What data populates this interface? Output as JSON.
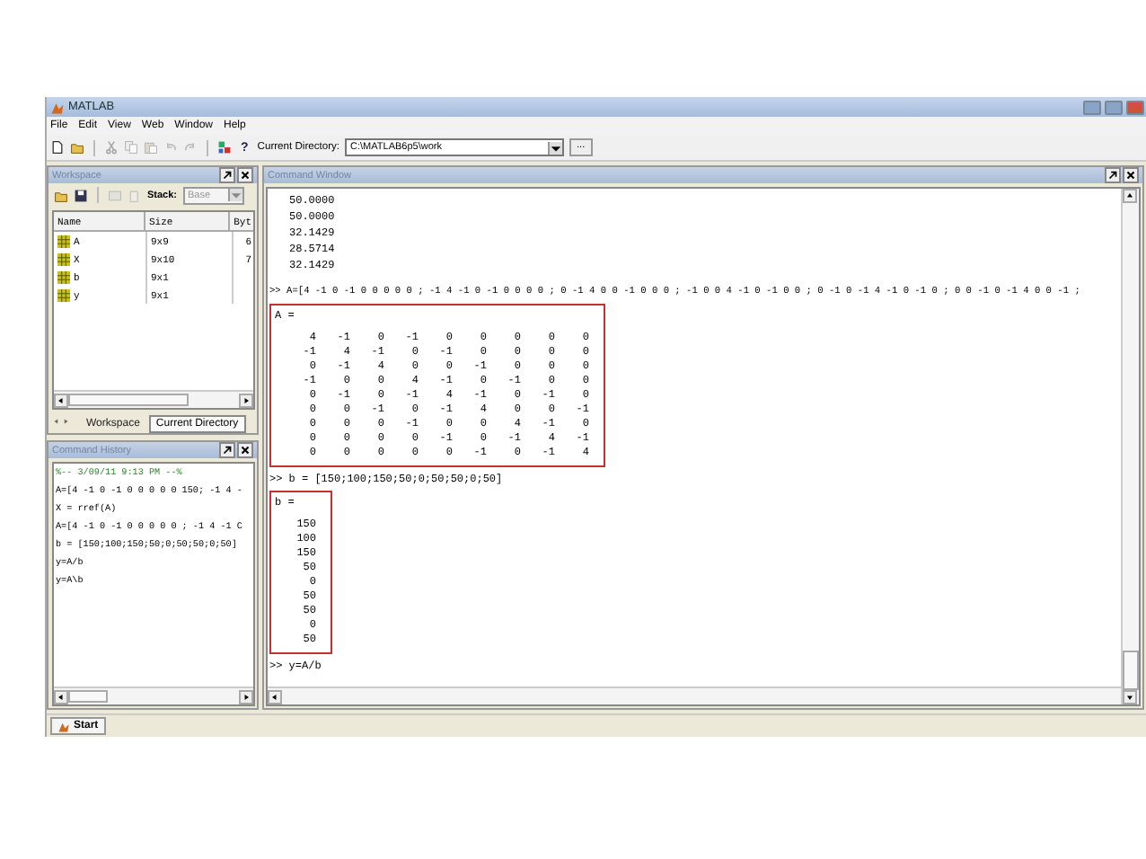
{
  "window": {
    "title": "MATLAB"
  },
  "menu": [
    "File",
    "Edit",
    "View",
    "Web",
    "Window",
    "Help"
  ],
  "toolbar": {
    "help": "?",
    "directory_label": "Current Directory:",
    "directory": "C:\\MATLAB6p5\\work",
    "browse": "..."
  },
  "workspace": {
    "title": "Workspace",
    "stack_label": "Stack:",
    "stack": "Base",
    "columns": [
      "Name",
      "Size",
      "Byt"
    ],
    "rows": [
      {
        "name": "A",
        "size": "9x9",
        "bytes": "6"
      },
      {
        "name": "X",
        "size": "9x10",
        "bytes": "7"
      },
      {
        "name": "b",
        "size": "9x1"
      },
      {
        "name": "y",
        "size": "9x1"
      }
    ],
    "tabs": [
      {
        "label": "Workspace",
        "selected": true
      },
      {
        "label": "Current Directory",
        "selected": false
      }
    ]
  },
  "command_history": {
    "title": "Command History",
    "lines": [
      {
        "kind": "session",
        "text": "%-- 3/09/11  9:13 PM --%"
      },
      {
        "kind": "command",
        "text": "A=[4 -1 0 -1 0 0 0 0 0 150; -1 4 -"
      },
      {
        "kind": "command",
        "text": "X = rref(A)"
      },
      {
        "kind": "command",
        "text": "A=[4 -1 0 -1 0 0 0 0 0 ; -1 4 -1 C"
      },
      {
        "kind": "command",
        "text": "b = [150;100;150;50;0;50;50;0;50]"
      },
      {
        "kind": "command",
        "text": "y=A/b"
      },
      {
        "kind": "command",
        "text": "y=A\\b"
      }
    ]
  },
  "command_window": {
    "title": "Command Window",
    "entries": [
      {
        "kind": "output",
        "text": "50.0000"
      },
      {
        "kind": "output",
        "text": "50.0000"
      },
      {
        "kind": "output",
        "text": "32.1429"
      },
      {
        "kind": "output",
        "text": "28.5714"
      },
      {
        "kind": "output",
        "text": "32.1429"
      },
      {
        "kind": "command",
        "text": ">> A=[4 -1 0 -1 0 0 0 0 0 ; -1 4 -1 0 -1 0 0  0 0 ; 0 -1 4 0 0 -1 0 0 0 ; -1 0 0 4 -1 0 -1 0 0 ; 0 -1 0 -1 4 -1 0 -1 0 ; 0 0 -1 0 -1 4 0 0 -1 ;"
      },
      {
        "kind": "result",
        "highlighted": true,
        "name": "A =",
        "rows": [
          [
            "4",
            "-1",
            "0",
            "-1",
            "0",
            "0",
            "0",
            "0",
            "0"
          ],
          [
            "-1",
            "4",
            "-1",
            "0",
            "-1",
            "0",
            "0",
            "0",
            "0"
          ],
          [
            "0",
            "-1",
            "4",
            "0",
            "0",
            "-1",
            "0",
            "0",
            "0"
          ],
          [
            "-1",
            "0",
            "0",
            "4",
            "-1",
            "0",
            "-1",
            "0",
            "0"
          ],
          [
            "0",
            "-1",
            "0",
            "-1",
            "4",
            "-1",
            "0",
            "-1",
            "0"
          ],
          [
            "0",
            "0",
            "-1",
            "0",
            "-1",
            "4",
            "0",
            "0",
            "-1"
          ],
          [
            "0",
            "0",
            "0",
            "-1",
            "0",
            "0",
            "4",
            "-1",
            "0"
          ],
          [
            "0",
            "0",
            "0",
            "0",
            "-1",
            "0",
            "-1",
            "4",
            "-1"
          ],
          [
            "0",
            "0",
            "0",
            "0",
            "0",
            "-1",
            "0",
            "-1",
            "4"
          ]
        ]
      },
      {
        "kind": "command",
        "text": ">> b = [150;100;150;50;0;50;50;0;50]"
      },
      {
        "kind": "result",
        "highlighted": true,
        "name": "b =",
        "rows": [
          [
            "150"
          ],
          [
            "100"
          ],
          [
            "150"
          ],
          [
            "50"
          ],
          [
            "0"
          ],
          [
            "50"
          ],
          [
            "50"
          ],
          [
            "0"
          ],
          [
            "50"
          ]
        ]
      },
      {
        "kind": "command",
        "text": ">> y=A/b"
      }
    ]
  },
  "taskbar": {
    "start": "Start"
  }
}
